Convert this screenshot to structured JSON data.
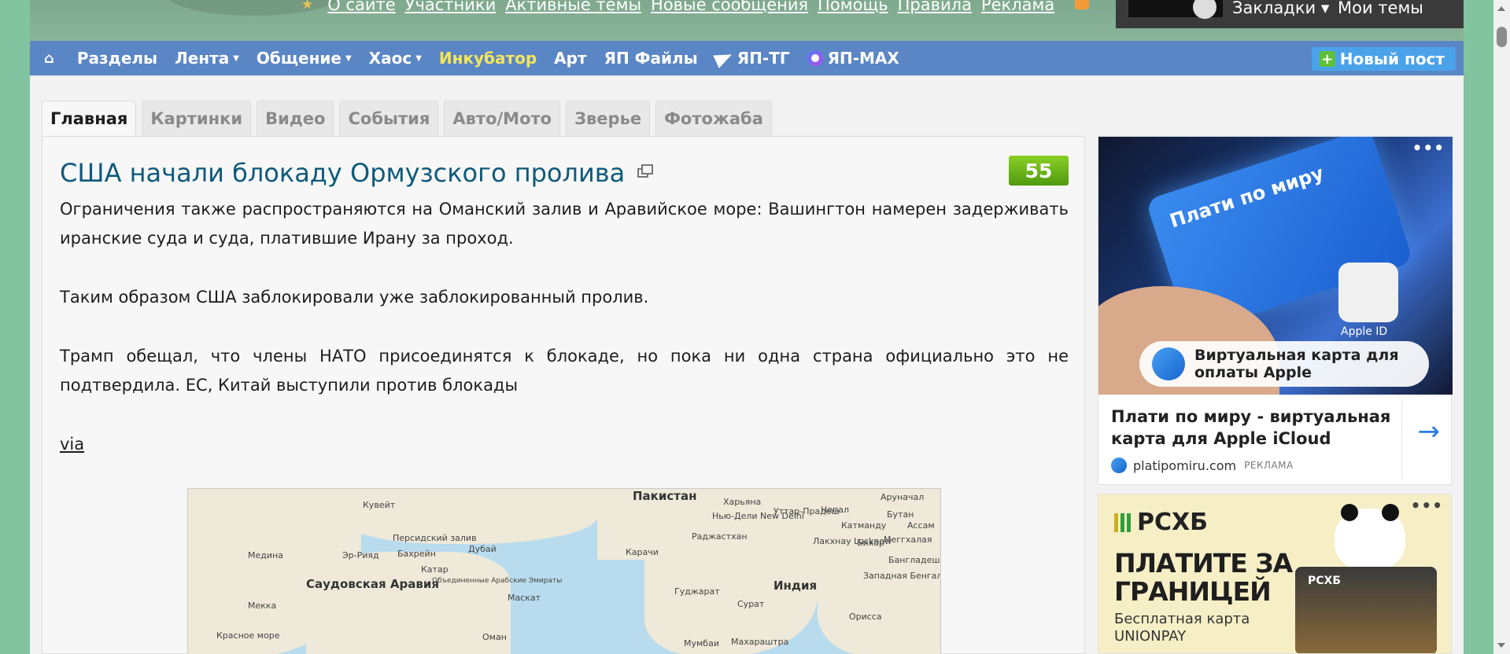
{
  "top_links": [
    "О сайте",
    "Участники",
    "Активные темы",
    "Новые сообщения",
    "Помощь",
    "Правила",
    "Реклама"
  ],
  "user": {
    "bookmarks": "Закладки ▾",
    "my_topics": "Мои темы"
  },
  "nav": {
    "items": [
      "Разделы",
      "Лента",
      "Общение",
      "Хаос",
      "Инкубатор",
      "Арт",
      "ЯП Файлы",
      "ЯП-ТГ",
      "ЯП-MAX"
    ],
    "new_post": "Новый пост"
  },
  "tabs": [
    "Главная",
    "Картинки",
    "Видео",
    "События",
    "Авто/Мото",
    "Зверье",
    "Фотожаба"
  ],
  "post": {
    "title": "США начали блокаду Ормузского пролива",
    "rating": "55",
    "paragraphs": [
      "Ограничения также распространяются на Оманский залив и Аравийское море: Вашингтон намерен задерживать иранские суда и суда, платившие Ирану за проход.",
      "Таким образом США заблокировали уже заблокированный пролив.",
      "Трамп обещал, что члены НАТО присоединятся к блокаде, но пока ни одна страна официально это не подтвердила. ЕС, Китай выступили против блокады"
    ],
    "via": "via"
  },
  "map": {
    "labels": [
      "Пакистан",
      "Кувейт",
      "Саудовская Аравия",
      "Медина",
      "Эр-Рияд",
      "Бахрейн",
      "Катар",
      "Дубай",
      "Объединенные Арабские Эмираты",
      "Маскат",
      "Мекка",
      "Оман",
      "Карачи",
      "Индия",
      "Нью-Дели New Delhi",
      "Непал",
      "Катманду",
      "Бутан",
      "Лакхнау Lucknow",
      "Бангладеш",
      "Мумбаи",
      "Сурат",
      "Гуджарат",
      "Раджастхан",
      "Уттар-Прадеш",
      "Харьяна",
      "Бихар",
      "Ассам",
      "Западная Бенгалия",
      "Орисса",
      "Махараштра",
      "Меггхалая",
      "Аруначал",
      "Красное море",
      "Персидский залив"
    ]
  },
  "ads": {
    "ad1": {
      "card_text": "Плати по миру",
      "apple_id": "Apple ID",
      "pill_text": "Виртуальная карта для оплаты Apple",
      "title": "Плати по миру - виртуальная карта для Apple iCloud",
      "domain": "platipomiru.com",
      "label": "РЕКЛАМА"
    },
    "ad2": {
      "brand": "РСХБ",
      "headline": "ПЛАТИТЕ ЗА ГРАНИЦЕЙ",
      "sub": "Бесплатная карта UNIONPAY",
      "card_brand": "РСХБ"
    },
    "menu": "•••"
  }
}
